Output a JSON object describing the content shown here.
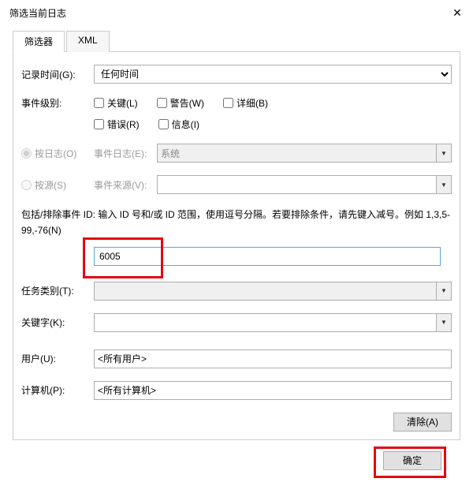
{
  "window": {
    "title": "筛选当前日志",
    "close": "✕"
  },
  "tabs": {
    "filter": "筛选器",
    "xml": "XML"
  },
  "form": {
    "logged_label": "记录时间(G):",
    "logged_value": "任何时间",
    "level_label": "事件级别:",
    "levels": {
      "critical": "关键(L)",
      "warning": "警告(W)",
      "verbose": "详细(B)",
      "error": "错误(R)",
      "info": "信息(I)"
    },
    "by_log_label": "按日志(O)",
    "event_log_label": "事件日志(E):",
    "event_log_value": "系统",
    "by_source_label": "按源(S)",
    "event_source_label": "事件来源(V):",
    "event_source_value": "",
    "id_help": "包括/排除事件 ID: 输入 ID 号和/或 ID 范围，使用逗号分隔。若要排除条件，请先键入减号。例如 1,3,5-99,-76(N)",
    "id_value": "6005",
    "task_label": "任务类别(T):",
    "task_value": "",
    "keywords_label": "关键字(K):",
    "keywords_value": "",
    "user_label": "用户(U):",
    "user_value": "<所有用户>",
    "computer_label": "计算机(P):",
    "computer_value": "<所有计算机>",
    "clear_btn": "清除(A)",
    "ok_btn": "确定"
  }
}
